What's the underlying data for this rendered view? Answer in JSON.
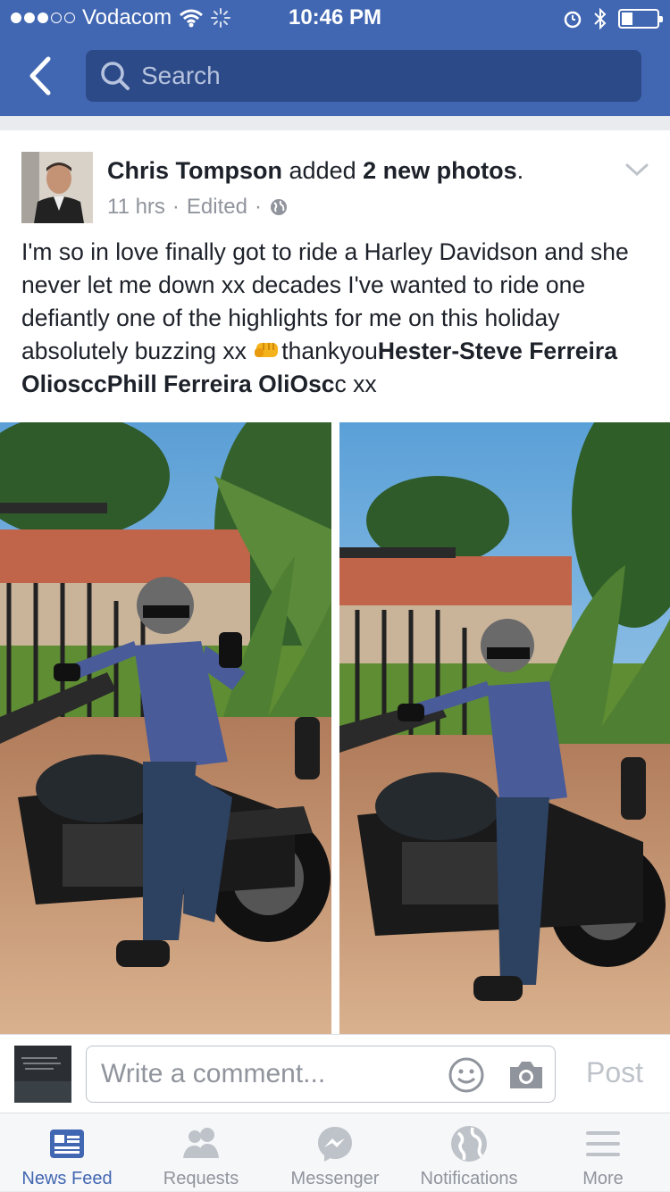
{
  "status_bar": {
    "carrier": "Vodacom",
    "time": "10:46 PM",
    "signal_strength": 3,
    "signal_max": 5
  },
  "search": {
    "placeholder": "Search"
  },
  "post": {
    "author": "Chris Tompson",
    "action_text": "added",
    "action_target": "2 new photos",
    "action_end": ".",
    "time": "11 hrs",
    "edited": "Edited",
    "separator": "·",
    "privacy_icon": "globe-icon",
    "text_plain": "I'm so in love finally got to ride a Harley Davidson and she never let me down xx decades I've wanted to ride one defiantly one of the highlights for me on this holiday absolutely buzzing xx",
    "text_thanks": "thankyou",
    "mention_1": "Hester-Steve Ferreira OliosccPhill Ferreira OliOsc",
    "text_end": "c xx",
    "photos": [
      "photo-1",
      "photo-2"
    ]
  },
  "comment": {
    "placeholder": "Write a comment...",
    "post_label": "Post"
  },
  "tabs": [
    {
      "label": "News Feed",
      "icon": "news-feed-icon",
      "active": true
    },
    {
      "label": "Requests",
      "icon": "friend-requests-icon",
      "active": false
    },
    {
      "label": "Messenger",
      "icon": "messenger-icon",
      "active": false
    },
    {
      "label": "Notifications",
      "icon": "globe-icon",
      "active": false
    },
    {
      "label": "More",
      "icon": "menu-icon",
      "active": false
    }
  ],
  "colors": {
    "brand": "#4267b2",
    "text": "#1d2129",
    "meta": "#90949c"
  }
}
